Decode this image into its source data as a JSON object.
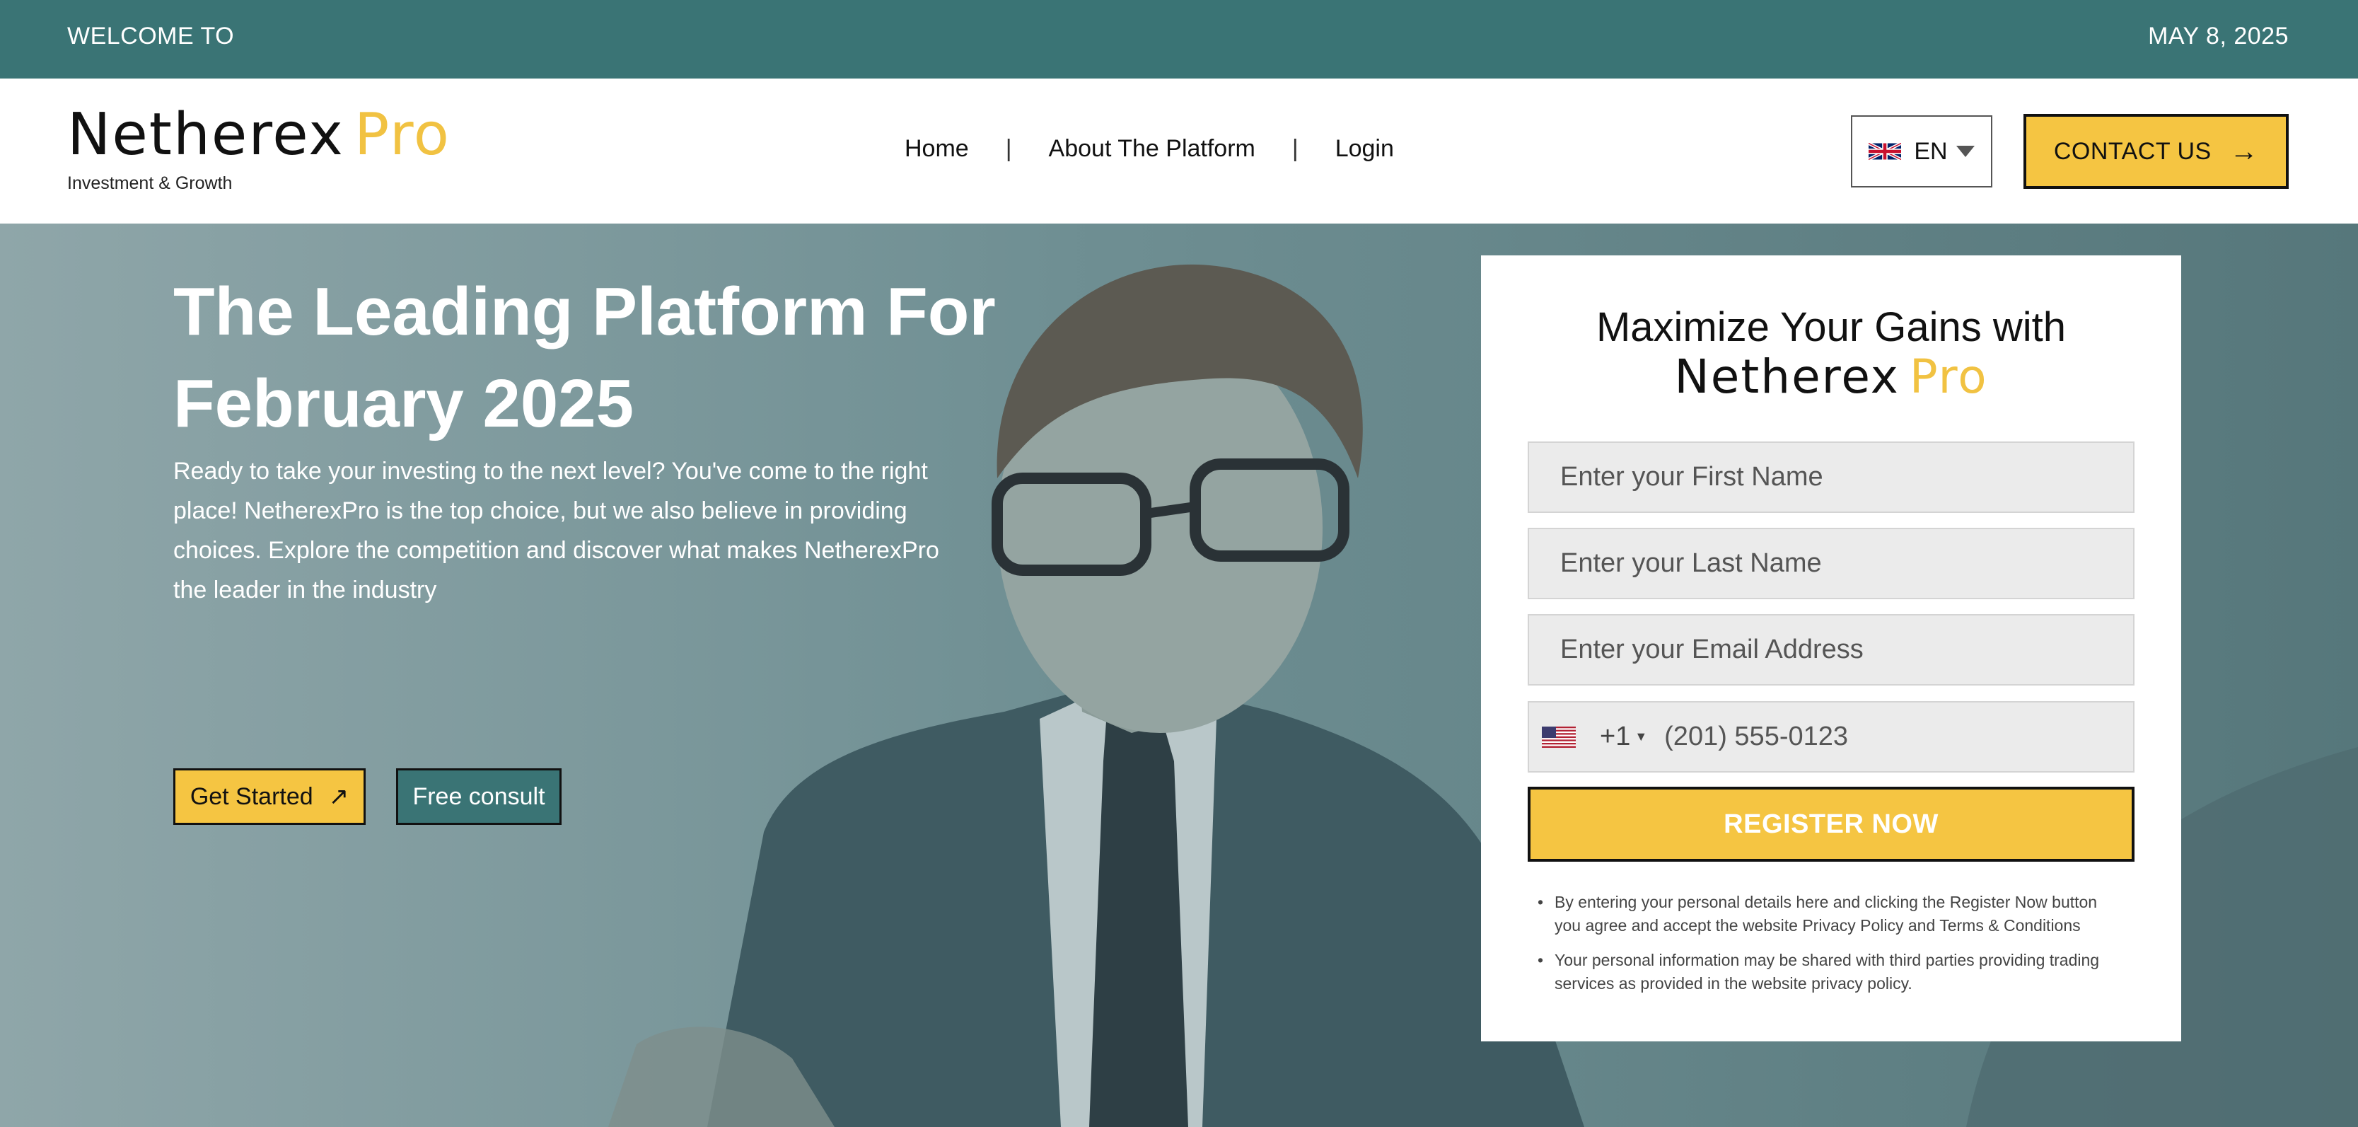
{
  "topbar": {
    "welcome": "WELCOME TO",
    "date": "MAY 8, 2025"
  },
  "brand": {
    "name_main": "Netherex",
    "name_accent": "Pro",
    "tagline": "Investment & Growth"
  },
  "nav": {
    "items": [
      {
        "label": "Home"
      },
      {
        "label": "About The Platform"
      },
      {
        "label": "Login"
      }
    ],
    "separator": "|"
  },
  "language": {
    "code": "EN",
    "flag": "uk-flag-icon"
  },
  "contact": {
    "label": "CONTACT US",
    "icon": "arrow-right-icon"
  },
  "hero": {
    "title": "The Leading Platform For February 2025",
    "description": "Ready to take your investing to the next level? You've come to the right place! NetherexPro is the top choice, but we also believe in providing choices. Explore the competition and discover what makes NetherexPro the leader in the industry",
    "get_started": "Get Started",
    "get_started_icon": "arrow-up-right-icon",
    "free_consult": "Free consult"
  },
  "form": {
    "heading": "Maximize Your Gains with",
    "first_name_placeholder": "Enter your First Name",
    "last_name_placeholder": "Enter your Last Name",
    "email_placeholder": "Enter your Email Address",
    "phone_flag": "us-flag-icon",
    "phone_code": "+1",
    "phone_placeholder": "(201) 555-0123",
    "register_label": "REGISTER NOW",
    "disclaimers": [
      "By entering your personal details here and clicking the Register Now button you agree and accept the website Privacy Policy and Terms & Conditions",
      "Your personal information may be shared with third parties providing trading services as provided in the website privacy policy."
    ]
  },
  "colors": {
    "teal": "#3a7475",
    "gold": "#f5c542",
    "overlay": "#60868a"
  }
}
